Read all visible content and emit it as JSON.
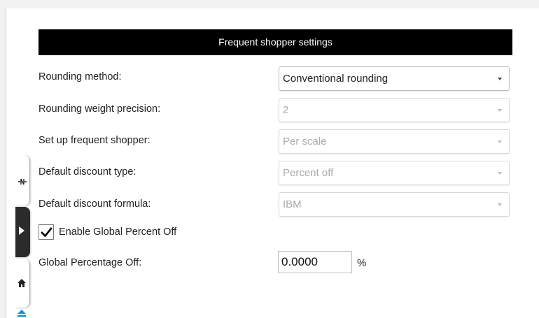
{
  "title": "Frequent shopper settings",
  "rows": [
    {
      "label": "Rounding method:",
      "value": "Conventional rounding",
      "enabled": true
    },
    {
      "label": "Rounding weight precision:",
      "value": "2",
      "enabled": false
    },
    {
      "label": "Set up frequent shopper:",
      "value": "Per scale",
      "enabled": false
    },
    {
      "label": "Default discount type:",
      "value": "Percent off",
      "enabled": false
    },
    {
      "label": "Default discount formula:",
      "value": "IBM",
      "enabled": false
    }
  ],
  "global_percent": {
    "checkbox_label": "Enable Global Percent Off",
    "checked": true,
    "label": "Global Percentage Off:",
    "value": "0.0000",
    "unit": "%"
  },
  "side_tabs": {
    "icons": [
      "scale-icon",
      "play-icon",
      "home-icon",
      "eject-icon"
    ]
  },
  "colors": {
    "title_bg": "#000000",
    "accent": "#1e90d6"
  }
}
